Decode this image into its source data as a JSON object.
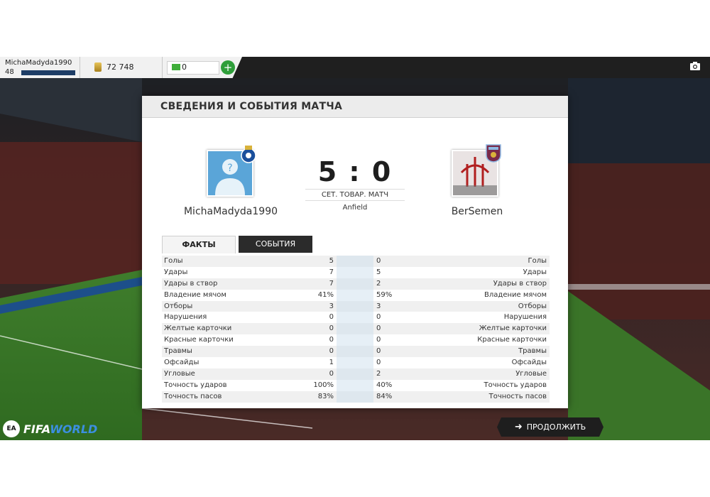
{
  "topbar": {
    "username": "MichaMadyda1990",
    "level": "48",
    "coins": "72 748",
    "points": "0",
    "add_label": "+",
    "camera_icon": "camera-icon"
  },
  "modal": {
    "title": "СВЕДЕНИЯ И СОБЫТИЯ МАТЧА",
    "home_team": "MichaMadyda1990",
    "away_team": "BerSemen",
    "score": "5 : 0",
    "match_type": "СЕТ. ТОВАР. МАТЧ",
    "venue": "Anfield",
    "tabs": [
      "ФАКТЫ",
      "СОБЫТИЯ"
    ],
    "stats": [
      {
        "label": "Голы",
        "home": "5",
        "away": "0"
      },
      {
        "label": "Удары",
        "home": "7",
        "away": "5"
      },
      {
        "label": "Удары в створ",
        "home": "7",
        "away": "2"
      },
      {
        "label": "Владение мячом",
        "home": "41%",
        "away": "59%"
      },
      {
        "label": "Отборы",
        "home": "3",
        "away": "3"
      },
      {
        "label": "Нарушения",
        "home": "0",
        "away": "0"
      },
      {
        "label": "Желтые карточки",
        "home": "0",
        "away": "0"
      },
      {
        "label": "Красные карточки",
        "home": "0",
        "away": "0"
      },
      {
        "label": "Травмы",
        "home": "0",
        "away": "0"
      },
      {
        "label": "Офсайды",
        "home": "1",
        "away": "0"
      },
      {
        "label": "Угловые",
        "home": "0",
        "away": "2"
      },
      {
        "label": "Точность ударов",
        "home": "100%",
        "away": "40%"
      },
      {
        "label": "Точность пасов",
        "home": "83%",
        "away": "84%"
      }
    ]
  },
  "footer": {
    "logo_ea": "EA",
    "logo_fifa": "FIFA",
    "logo_world": "WORLD",
    "continue_label": "ПРОДОЛЖИТЬ"
  },
  "colors": {
    "accent_blue": "#5aa5d8",
    "plus_green": "#2f9e3a",
    "dark_bar": "#1f1f1f"
  }
}
